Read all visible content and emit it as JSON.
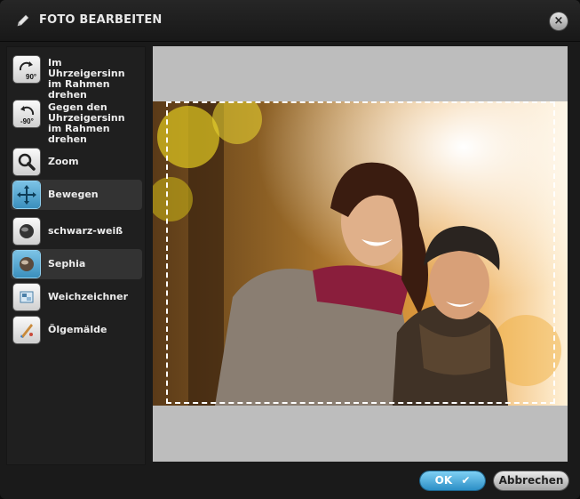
{
  "dialog": {
    "title": "FOTO BEARBEITEN",
    "close_glyph": "×"
  },
  "tools": [
    {
      "label": "Im Uhrzeigersinn im Rahmen drehen",
      "icon": "rotate-cw-90-icon",
      "badge": "90°",
      "active": false
    },
    {
      "label": "Gegen den Uhrzeigersinn im Rahmen drehen",
      "icon": "rotate-ccw-90-icon",
      "badge": "-90°",
      "active": false
    },
    {
      "label": "Zoom",
      "icon": "magnifier-icon",
      "active": false
    },
    {
      "label": "Bewegen",
      "icon": "move-arrows-icon",
      "active": true
    },
    {
      "label": "schwarz-weiß",
      "icon": "black-white-icon",
      "active": false
    },
    {
      "label": "Sephia",
      "icon": "sepia-icon",
      "active": true
    },
    {
      "label": "Weichzeichner",
      "icon": "blur-icon",
      "active": false
    },
    {
      "label": "Ölgemälde",
      "icon": "oil-painting-icon",
      "active": false
    }
  ],
  "buttons": {
    "ok_label": "OK",
    "ok_glyph": "✔",
    "cancel_label": "Abbrechen"
  },
  "colors": {
    "accent": "#3a9fd4",
    "dialog_bg": "#1a1a1a",
    "canvas_bg": "#bdbdbd"
  }
}
